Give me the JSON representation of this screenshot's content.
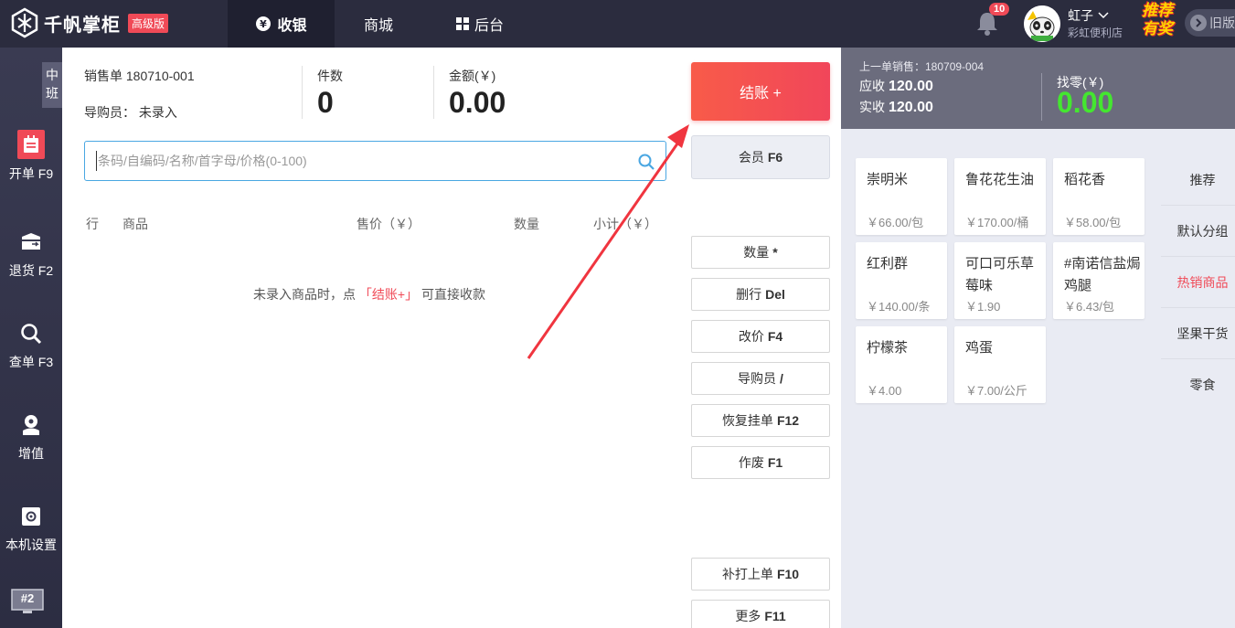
{
  "topbar": {
    "logo_text": "千帆掌柜",
    "edition_badge": "高级版",
    "tabs": [
      {
        "label": "收银",
        "icon": "yen-circle-icon",
        "active": true
      },
      {
        "label": "商城",
        "active": false
      },
      {
        "label": "后台",
        "icon": "grid-icon",
        "active": false
      }
    ],
    "notification_count": "10",
    "user_name": "虹子",
    "store_name": "彩虹便利店",
    "promo_line1": "推荐",
    "promo_line2": "有奖",
    "old_version": "旧版"
  },
  "sidebar": {
    "shift": "中班",
    "items": [
      {
        "label": "开单 F9",
        "icon": "order-icon",
        "active": true
      },
      {
        "label": "退货 F2",
        "icon": "return-box-icon"
      },
      {
        "label": "查单 F3",
        "icon": "search-icon"
      },
      {
        "label": "增值",
        "icon": "value-added-icon"
      },
      {
        "label": "本机设置",
        "icon": "settings-icon"
      }
    ],
    "terminal": "#2"
  },
  "order": {
    "number_label": "销售单",
    "number": "180710-001",
    "guide_label": "导购员：",
    "guide_value": "未录入",
    "count_label": "件数",
    "count_value": "0",
    "amount_label": "金额(￥)",
    "amount_value": "0.00"
  },
  "search": {
    "placeholder": "条码/自编码/名称/首字母/价格(0-100)"
  },
  "table": {
    "headers": [
      "行",
      "商品",
      "售价（￥）",
      "数量",
      "小计（￥）"
    ],
    "empty_prefix": "未录入商品时，点",
    "empty_highlight": "「结账+」",
    "empty_suffix": "可直接收款"
  },
  "actions": {
    "checkout": "结账 +",
    "member": {
      "label": "会员",
      "key": "F6"
    },
    "ops": [
      {
        "label": "数量",
        "key": "*"
      },
      {
        "label": "删行",
        "key": "Del"
      },
      {
        "label": "改价",
        "key": "F4"
      },
      {
        "label": "导购员",
        "key": "/"
      },
      {
        "label": "恢复挂单",
        "key": "F12"
      },
      {
        "label": "作废",
        "key": "F1"
      }
    ],
    "reprint": {
      "label": "补打上单",
      "key": "F10"
    },
    "more": {
      "label": "更多",
      "key": "F11"
    }
  },
  "last_sale": {
    "label": "上一单销售：180709-004",
    "receivable_label": "应收",
    "receivable": "120.00",
    "received_label": "实收",
    "received": "120.00",
    "change_label": "找零(￥)",
    "change": "0.00"
  },
  "products": [
    {
      "name": "崇明米",
      "price": "￥66.00/包"
    },
    {
      "name": "鲁花花生油",
      "price": "￥170.00/桶"
    },
    {
      "name": "稻花香",
      "price": "￥58.00/包"
    },
    {
      "name": "红利群",
      "price": "￥140.00/条"
    },
    {
      "name": "可口可乐草莓味",
      "price": "￥1.90"
    },
    {
      "name": "#南诺信盐焗鸡腿",
      "price": "￥6.43/包"
    },
    {
      "name": "柠檬茶",
      "price": "￥4.00"
    },
    {
      "name": "鸡蛋",
      "price": "￥7.00/公斤"
    }
  ],
  "categories": [
    "推荐",
    "默认分组",
    "热销商品",
    "坚果干货",
    "零食"
  ],
  "active_category": "热销商品",
  "colors": {
    "accent_red": "#f04a57",
    "topbar": "#2b2c3e",
    "change_green": "#44e630",
    "search_border": "#4aa7e2"
  }
}
